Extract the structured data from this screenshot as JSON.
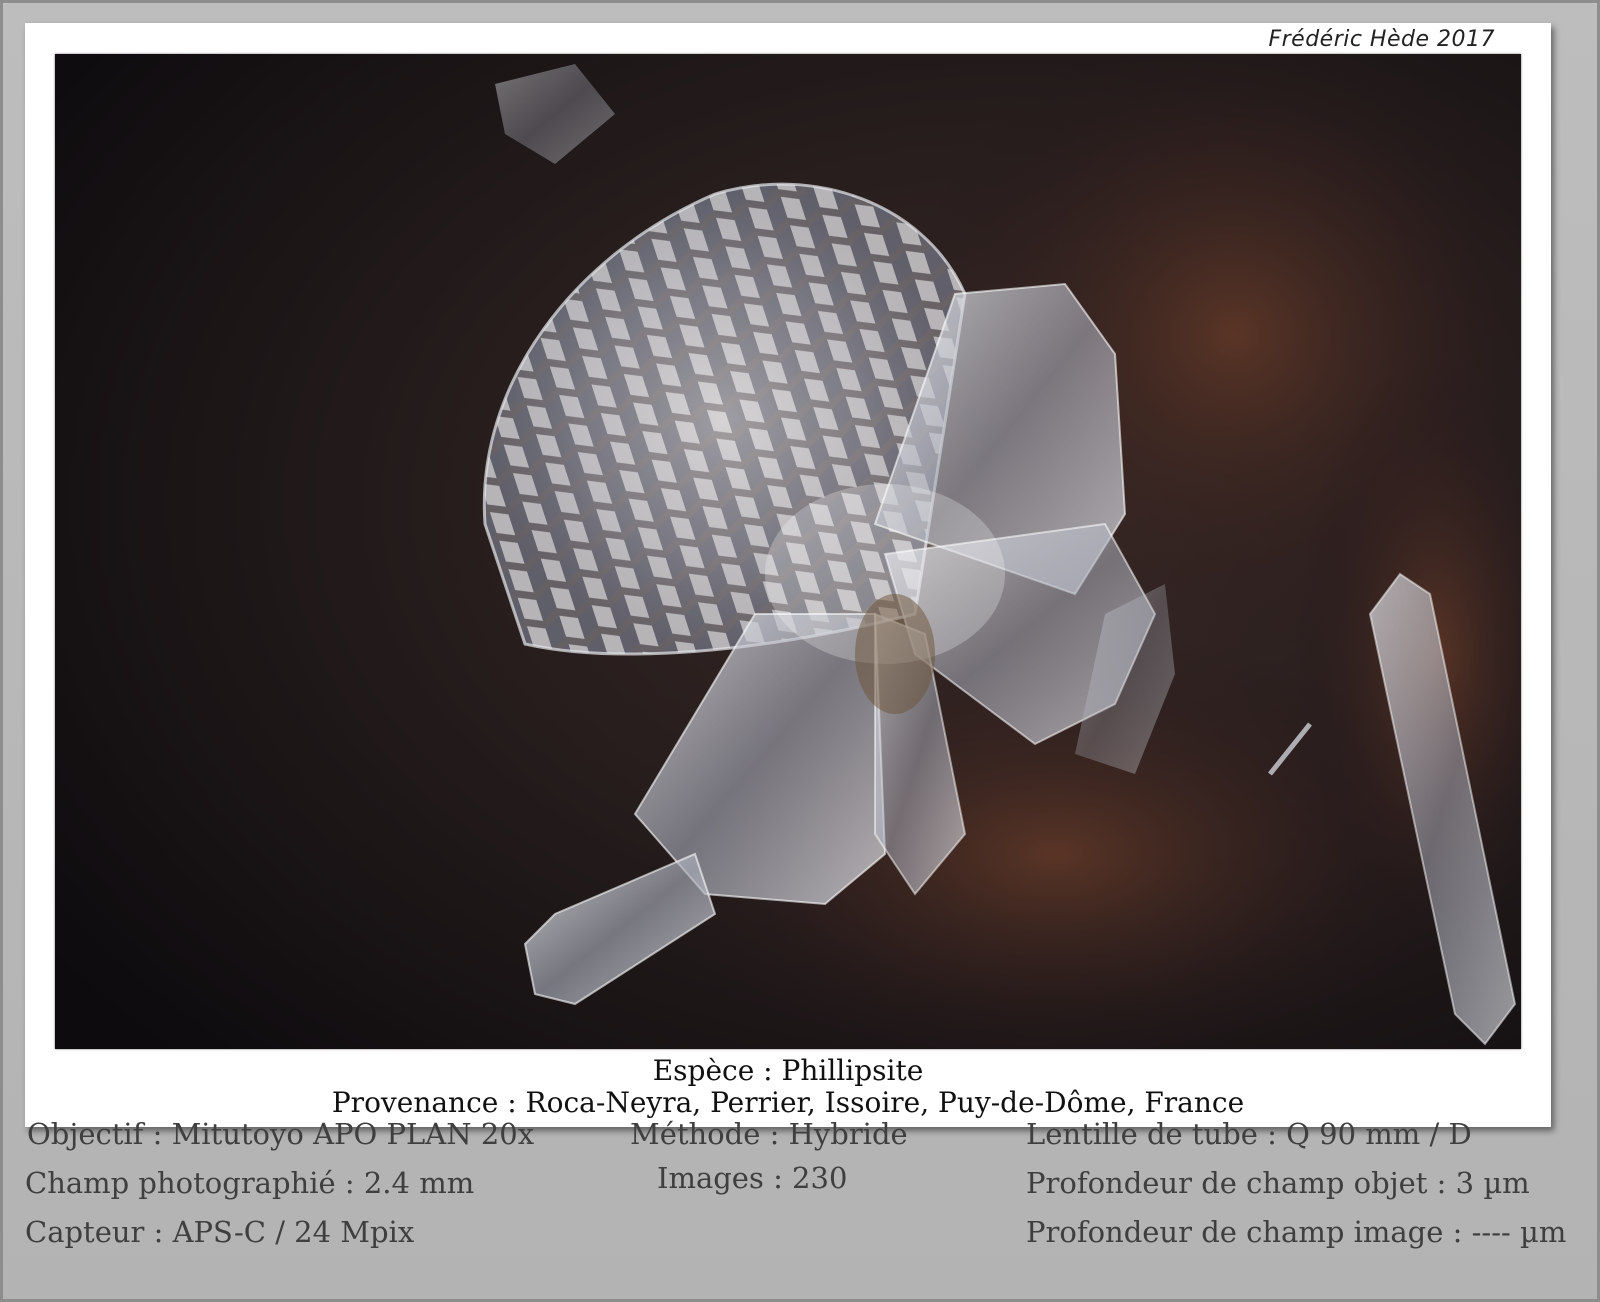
{
  "signature": "Frédéric Hède 2017",
  "photo": {
    "subject": "crystal-specimen"
  },
  "caption": {
    "species": "Espèce : Phillipsite",
    "origin": "Provenance : Roca-Neyra, Perrier, Issoire, Puy-de-Dôme, France"
  },
  "specs": {
    "objective": "Objectif : Mitutoyo APO PLAN 20x",
    "field": "Champ photographié : 2.4 mm",
    "sensor": "Capteur : APS-C / 24 Mpix",
    "method": "Méthode : Hybride",
    "images": "Images : 230",
    "tube_lens": "Lentille de tube : Q 90 mm / D",
    "object_dof": "Profondeur de champ objet : 3 µm",
    "image_dof": "Profondeur de champ image : ---- µm"
  },
  "colors": {
    "background": "#b7b7b7",
    "card": "#ffffff",
    "spec_text": "#3f3f3f"
  }
}
